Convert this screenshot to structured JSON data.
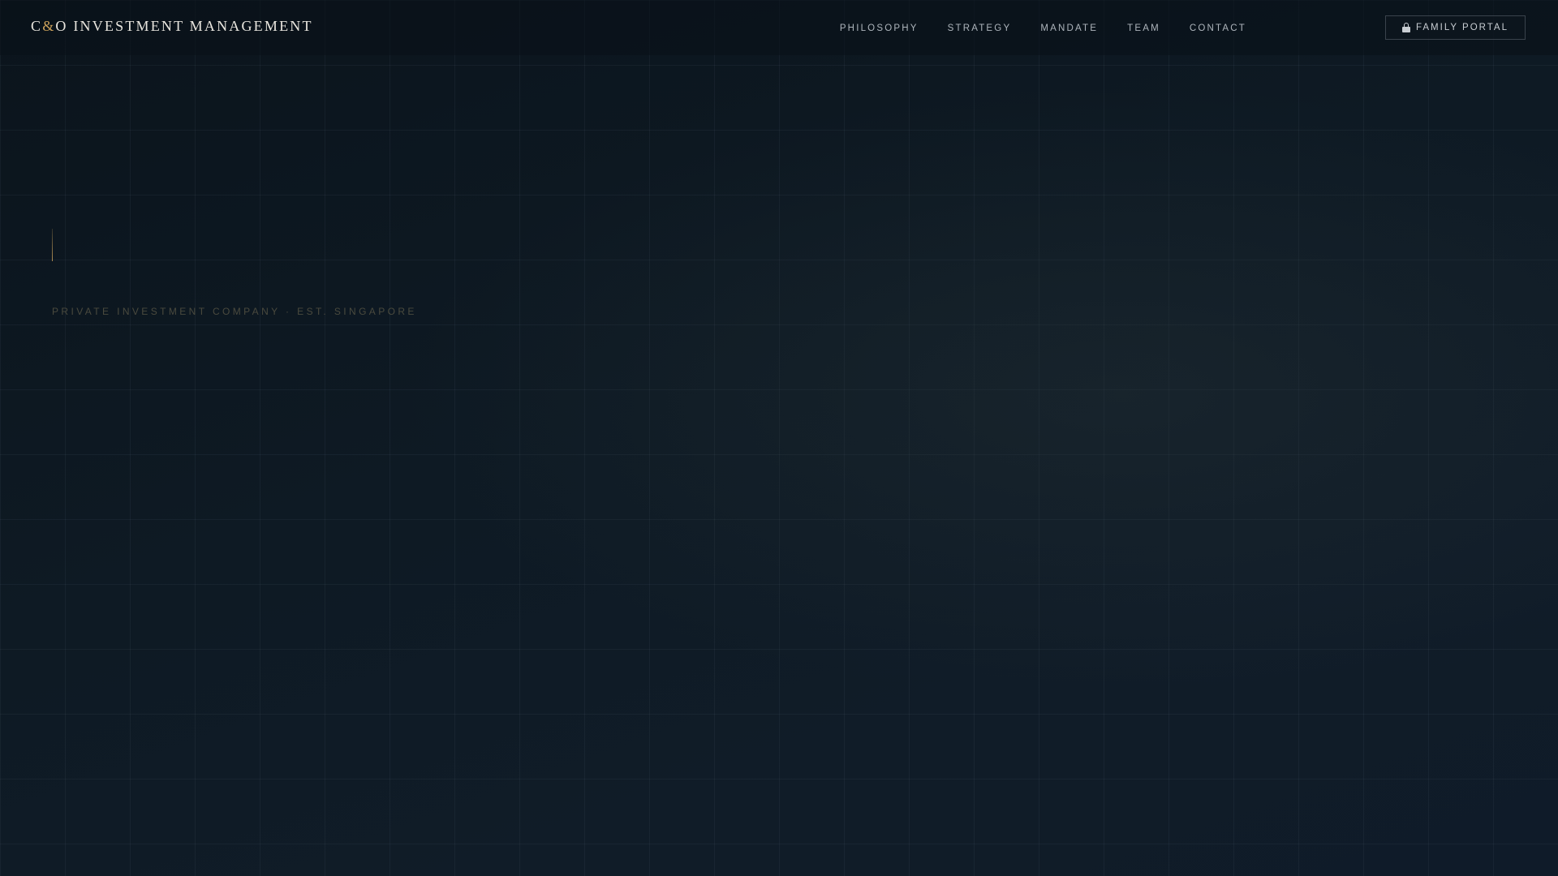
{
  "brand": {
    "prefix": "C",
    "ampersand": "&",
    "suffix": "O INVESTMENT MANAGEMENT",
    "accent_color": "#c9a05a"
  },
  "nav": {
    "items": [
      {
        "label": "PHILOSOPHY"
      },
      {
        "label": "STRATEGY"
      },
      {
        "label": "MANDATE"
      },
      {
        "label": "TEAM"
      },
      {
        "label": "CONTACT"
      }
    ],
    "portal": {
      "icon": "lock-icon",
      "label": "FAMILY PORTAL"
    }
  },
  "hero": {
    "tagline": "PRIVATE INVESTMENT COMPANY · EST. SINGAPORE"
  }
}
